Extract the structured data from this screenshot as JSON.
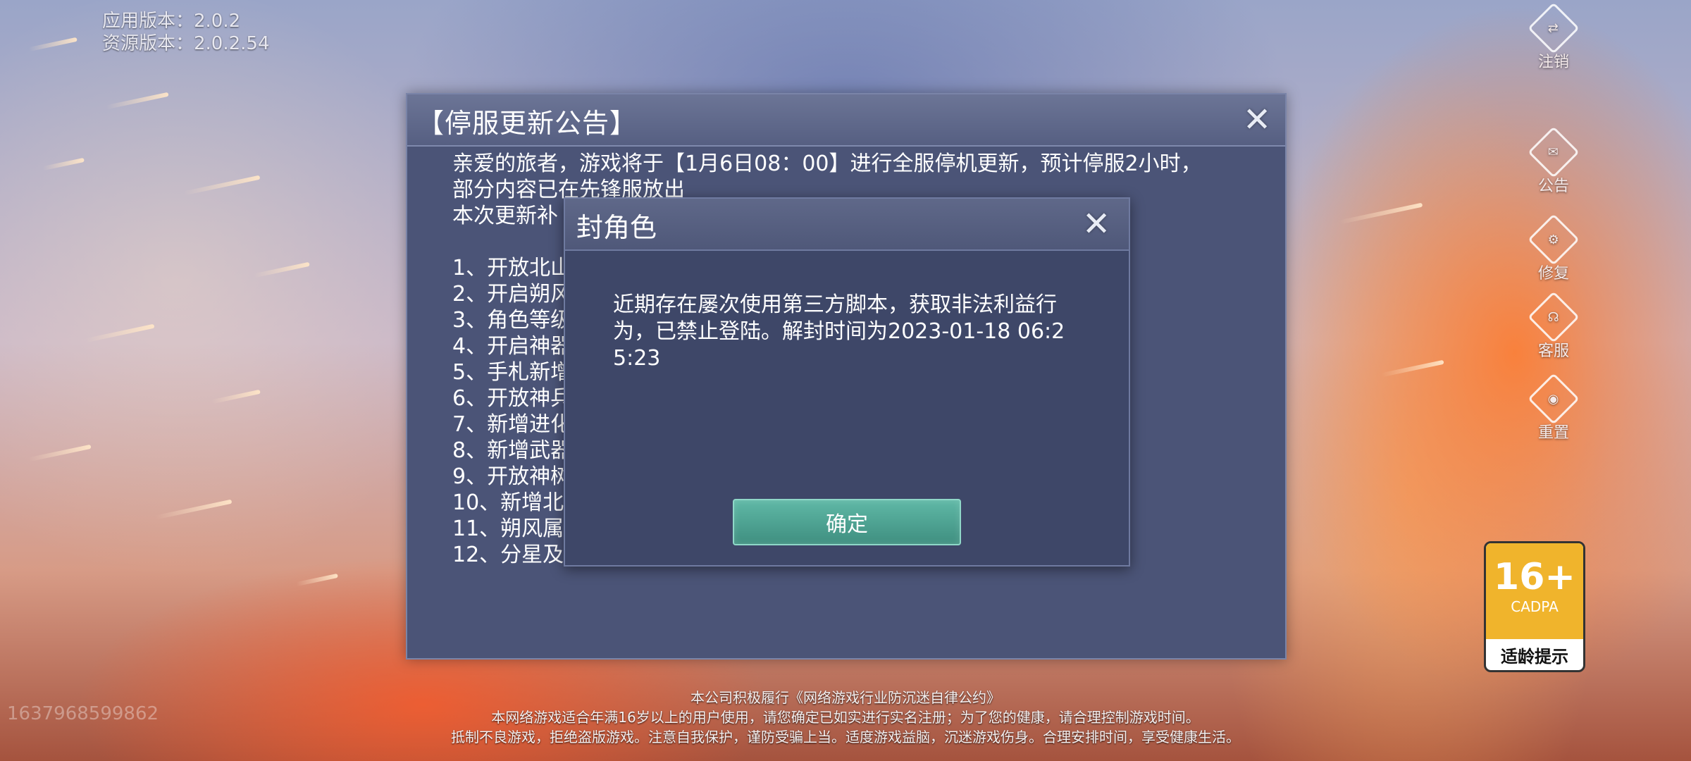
{
  "version": {
    "app": "应用版本：2.0.2",
    "resource": "资源版本：2.0.2.54"
  },
  "side_menu": [
    {
      "label": "注销",
      "icon": "logout-icon",
      "glyph": "⇄"
    },
    {
      "label": "公告",
      "icon": "announcement-icon",
      "glyph": "✉"
    },
    {
      "label": "修复",
      "icon": "repair-icon",
      "glyph": "⚙"
    },
    {
      "label": "客服",
      "icon": "customer-service-icon",
      "glyph": "☊"
    },
    {
      "label": "重置",
      "icon": "reset-icon",
      "glyph": "◉"
    }
  ],
  "notice": {
    "title": "【停服更新公告】",
    "lines": [
      "亲爱的旅者，游戏将于【1月6日08：00】进行全服停机更新，预计停服2小时，",
      "部分内容已在先锋服放出",
      "本次更新补",
      "",
      "1、开放北山",
      "2、开启朔风",
      "3、角色等级",
      "4、开启神器",
      "5、手札新增",
      "6、开放神兵",
      "7、新增进化",
      "8、新增武器",
      "9、开放神树",
      "10、新增北",
      "11、朔风属",
      "12、分星及"
    ]
  },
  "dialog": {
    "title": "封角色",
    "message": "近期存在屡次使用第三方脚本，获取非法利益行为，已禁止登陆。解封时间为2023-01-18 06:25:23",
    "ok_label": "确定"
  },
  "age_rating": {
    "number": "16+",
    "org": "CADPA",
    "label": "适龄提示"
  },
  "footer": {
    "line1": "本公司积极履行《网络游戏行业防沉迷自律公约》",
    "line2": "本网络游戏适合年满16岁以上的用户使用，请您确定已如实进行实名注册；为了您的健康，请合理控制游戏时间。",
    "line3": "抵制不良游戏，拒绝盗版游戏。注意自我保护，谨防受骗上当。适度游戏益脑，沉迷游戏伤身。合理安排时间，享受健康生活。"
  },
  "uid_watermark": "1637968599862"
}
